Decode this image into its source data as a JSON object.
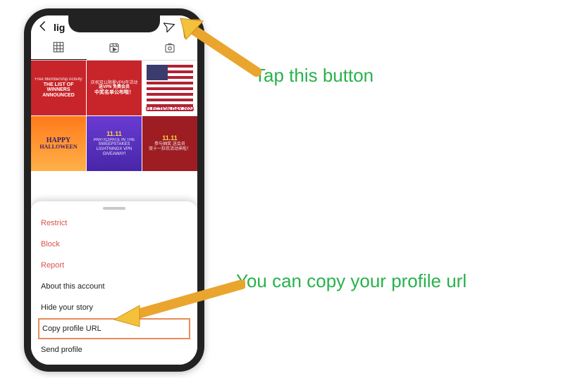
{
  "callouts": {
    "top": "Tap this button",
    "bottom": "You can copy your profile url"
  },
  "profile": {
    "username_truncated": "lig"
  },
  "tabs": {
    "grid": "posts-grid",
    "reels": "reels",
    "tagged": "tagged"
  },
  "posts": [
    {
      "title": "THE LIST OF WINNERS",
      "subtitle": "ANNOUNCED",
      "note": "Free Membership Activity",
      "style": "red"
    },
    {
      "title": "中奖名单公布啦！",
      "subtitle": "送VPN 免费会员",
      "note": "庆祝双11限量VPN年活动",
      "style": "red"
    },
    {
      "title": "ELECTION DAY",
      "subtitle": "2024",
      "style": "flag"
    },
    {
      "title": "HAPPY",
      "subtitle": "HALLOWEEN",
      "style": "halloween"
    },
    {
      "title": "11.11",
      "subtitle": "PARTICIPATE IN THE SWEEPSTAKES\nLIGHTNINGX VPN GIVEAWAY!",
      "style": "purple"
    },
    {
      "title": "11.11",
      "subtitle": "参与抽奖 送会员\n双十一狂欢活动来啦！",
      "style": "darkred"
    }
  ],
  "sheet": {
    "restrict": "Restrict",
    "block": "Block",
    "report": "Report",
    "about": "About this account",
    "hide": "Hide your story",
    "copy": "Copy profile URL",
    "send": "Send profile"
  }
}
